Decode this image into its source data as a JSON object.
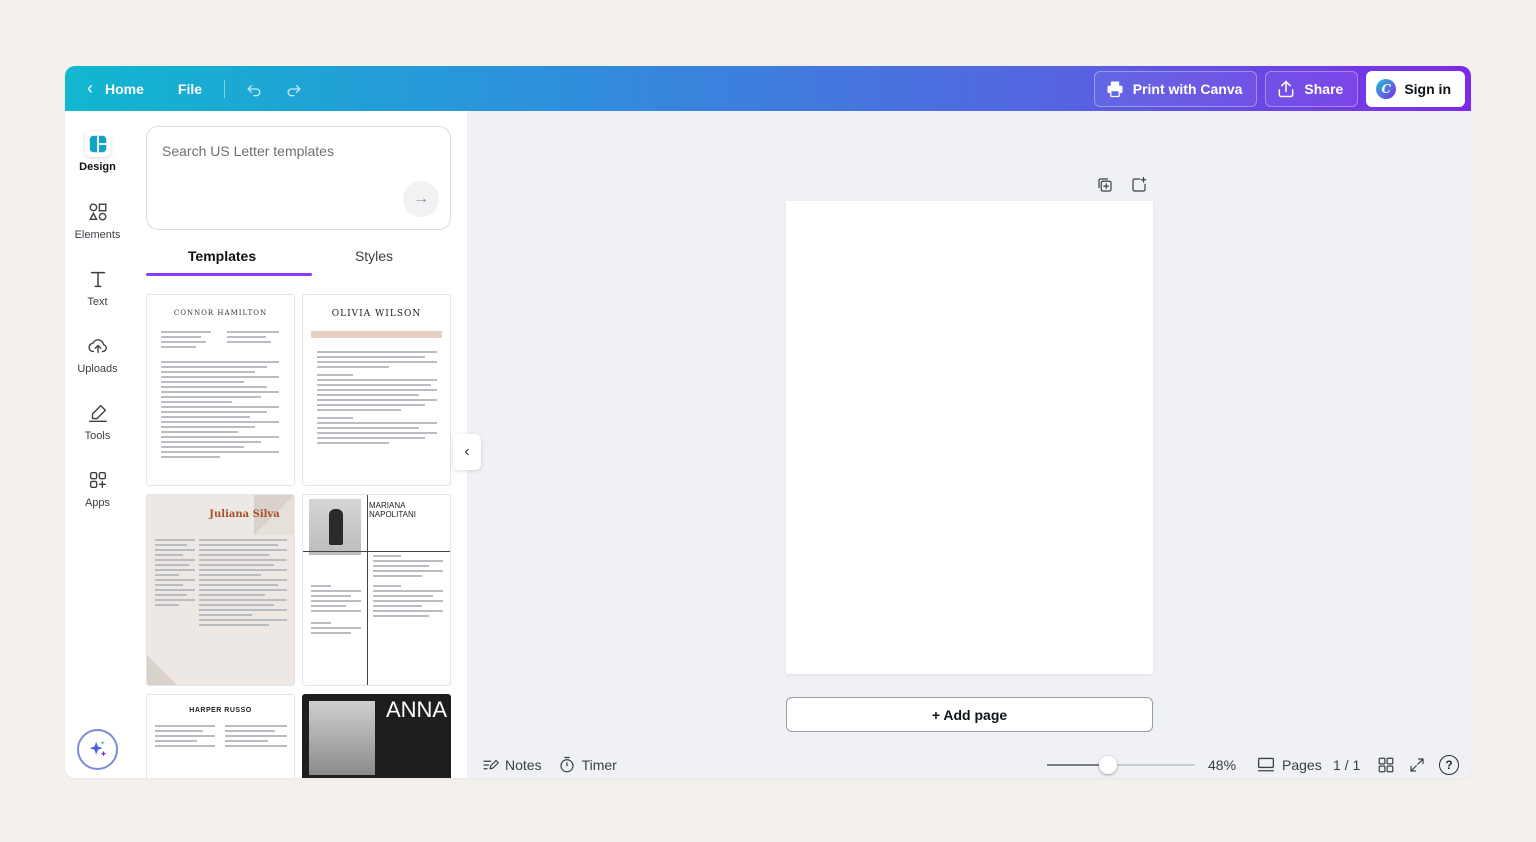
{
  "topbar": {
    "home_label": "Home",
    "file_label": "File",
    "print_label": "Print with Canva",
    "share_label": "Share",
    "signin_label": "Sign in"
  },
  "rail": {
    "items": [
      {
        "label": "Design"
      },
      {
        "label": "Elements"
      },
      {
        "label": "Text"
      },
      {
        "label": "Uploads"
      },
      {
        "label": "Tools"
      },
      {
        "label": "Apps"
      }
    ]
  },
  "panel": {
    "search_placeholder": "Search US Letter templates",
    "tabs": [
      "Templates",
      "Styles"
    ],
    "templates": [
      {
        "name": "CONNOR HAMILTON"
      },
      {
        "name": "OLIVIA WILSON"
      },
      {
        "name": "Juliana Silva"
      },
      {
        "name": "MARIANA NAPOLITANI"
      },
      {
        "name": "HARPER RUSSO"
      },
      {
        "name": "ANNA"
      }
    ]
  },
  "canvas": {
    "add_page_label": "+ Add page"
  },
  "bottom": {
    "notes_label": "Notes",
    "timer_label": "Timer",
    "zoom_value": "48%",
    "zoom_fraction": 0.41,
    "pages_label": "Pages",
    "page_count": "1 / 1"
  },
  "colors": {
    "accent": "#8b3dff",
    "topbar_start": "#11b7cf",
    "topbar_end": "#7d2ae8"
  }
}
